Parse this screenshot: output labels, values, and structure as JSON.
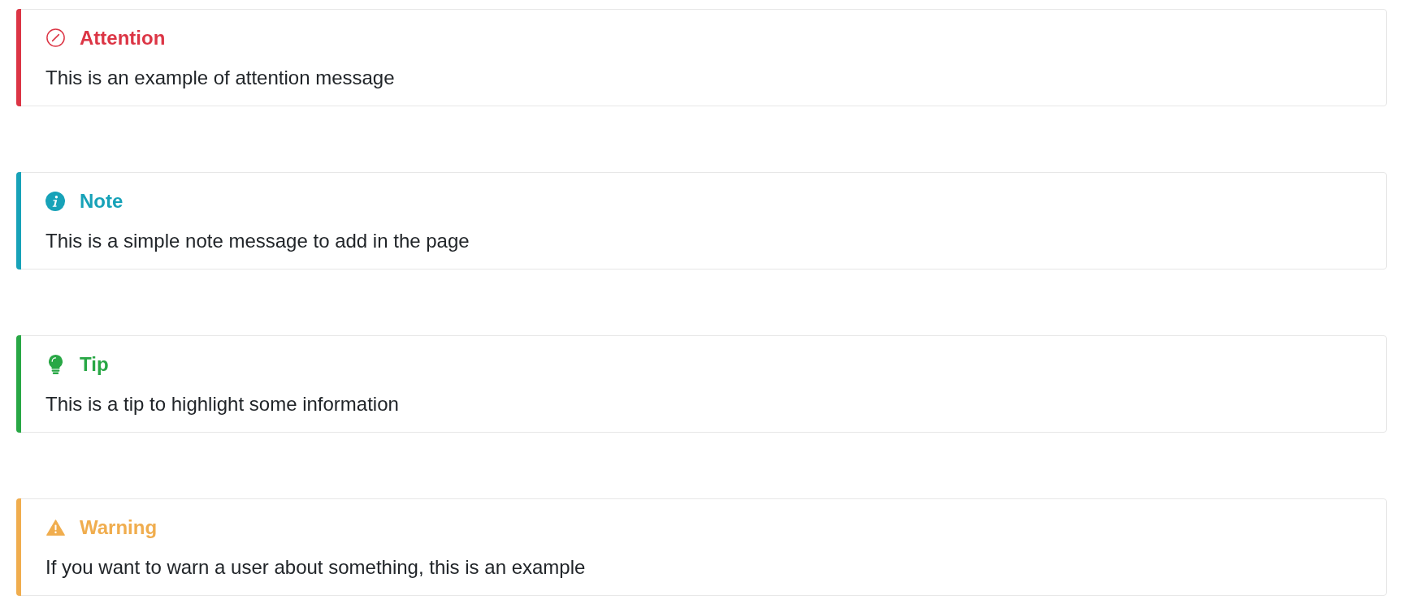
{
  "callouts": [
    {
      "kind": "attention",
      "color": "#dc3545",
      "title": "Attention",
      "message": "This is an example of attention message"
    },
    {
      "kind": "note",
      "color": "#17a2b8",
      "title": "Note",
      "message": "This is a simple note message to add in the page"
    },
    {
      "kind": "tip",
      "color": "#28a745",
      "title": "Tip",
      "message": "This is a tip to highlight some information"
    },
    {
      "kind": "warning",
      "color": "#f0ad4e",
      "title": "Warning",
      "message": "If you want to warn a user about something, this is an example"
    }
  ]
}
